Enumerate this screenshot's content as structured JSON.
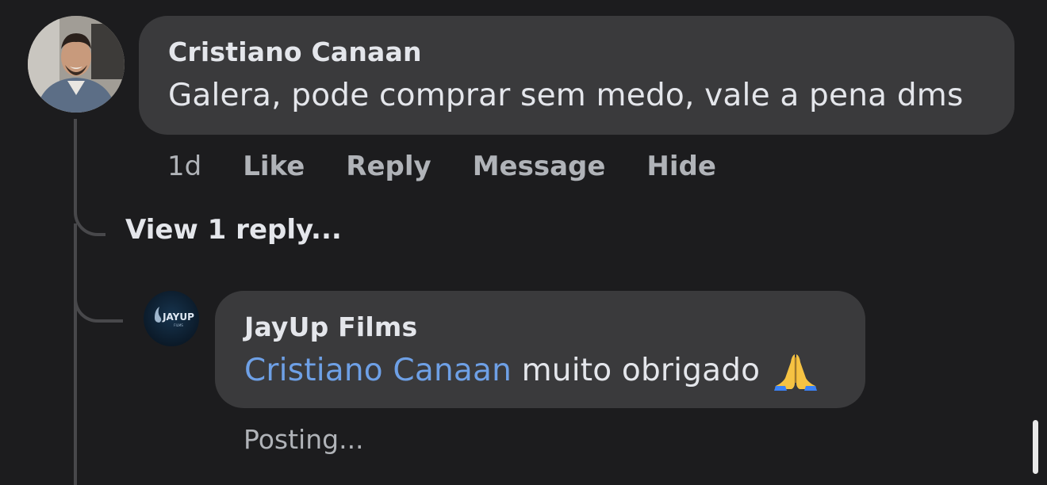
{
  "comment": {
    "author": "Cristiano Canaan",
    "text": "Galera, pode comprar sem medo, vale a pena dms",
    "avatar_icon": "user-photo-avatar"
  },
  "actions": {
    "time": "1d",
    "like": "Like",
    "reply": "Reply",
    "message": "Message",
    "hide": "Hide"
  },
  "view_replies": "View 1 reply...",
  "reply": {
    "author": "JayUp Films",
    "mention": "Cristiano Canaan",
    "text": " muito obrigado",
    "emoji_icon": "folded-hands-icon",
    "avatar_logo_text": "JAYUP",
    "avatar_logo_subtext": "FILMS",
    "status": "Posting..."
  },
  "colors": {
    "background": "#1c1c1e",
    "bubble": "#3a3a3c",
    "mention": "#6ea0e6",
    "secondary_text": "#b0b3b8"
  }
}
